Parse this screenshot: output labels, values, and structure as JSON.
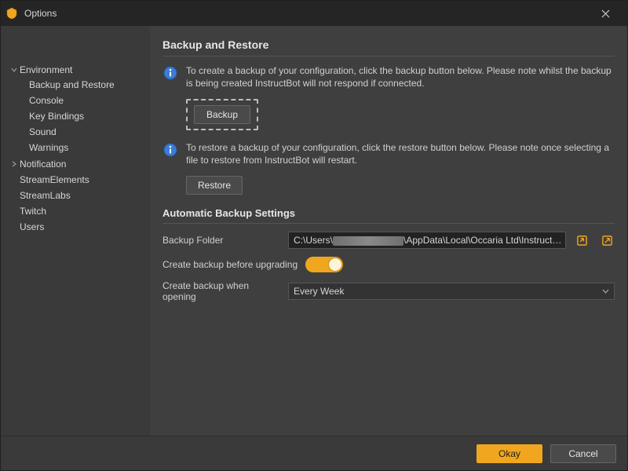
{
  "window": {
    "title": "Options"
  },
  "sidebar": {
    "items": [
      {
        "label": "Environment",
        "expanded": true,
        "children": [
          {
            "label": "Backup and Restore"
          },
          {
            "label": "Console"
          },
          {
            "label": "Key Bindings"
          },
          {
            "label": "Sound"
          },
          {
            "label": "Warnings"
          }
        ]
      },
      {
        "label": "Notification",
        "expanded": false
      },
      {
        "label": "StreamElements"
      },
      {
        "label": "StreamLabs"
      },
      {
        "label": "Twitch"
      },
      {
        "label": "Users"
      }
    ]
  },
  "main": {
    "title": "Backup and Restore",
    "backup_info": "To create a backup of your configuration, click the backup button below. Please note whilst the backup is being created InstructBot will not respond if connected.",
    "backup_button": "Backup",
    "restore_info": "To restore a backup of your configuration, click the restore button below. Please note once selecting a file to restore from InstructBot will restart.",
    "restore_button": "Restore",
    "auto_title": "Automatic Backup Settings",
    "folder_label": "Backup Folder",
    "folder_prefix": "C:\\Users\\",
    "folder_suffix": "\\AppData\\Local\\Occaria Ltd\\InstructBot\\backups\\",
    "upgrade_label": "Create backup before upgrading",
    "upgrade_toggle": true,
    "opening_label": "Create backup when opening",
    "opening_value": "Every Week"
  },
  "footer": {
    "okay": "Okay",
    "cancel": "Cancel"
  }
}
